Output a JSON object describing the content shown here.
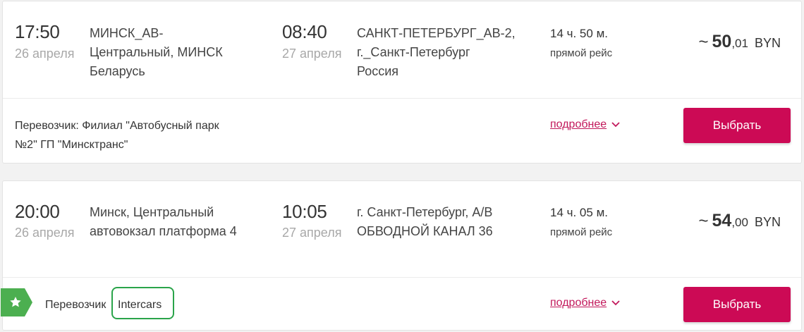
{
  "results": [
    {
      "depart_time": "17:50",
      "depart_date": "26 апреля",
      "depart_place_lines": [
        "МИНСК_АВ-",
        "Центральный, МИНСК",
        "Беларусь"
      ],
      "arrive_time": "08:40",
      "arrive_date": "27 апреля",
      "arrive_place_lines": [
        "САНКТ-ПЕТЕРБУРГ_АВ-2,",
        "г._Санкт-Петербург",
        "Россия"
      ],
      "duration": "14 ч. 50 м.",
      "trip_type": "прямой рейс",
      "price": {
        "approx": "~",
        "main": "50",
        "cents": ",01",
        "currency": "BYN"
      },
      "carrier_lines": [
        "Перевозчик: Филиал \"Автобусный парк",
        "№2\" ГП \"Минсктранс\""
      ],
      "more_label": "подробнее",
      "select_label": "Выбрать"
    },
    {
      "depart_time": "20:00",
      "depart_date": "26 апреля",
      "depart_place_lines": [
        "Минск, Центральный",
        "автовокзал платформа 4"
      ],
      "arrive_time": "10:05",
      "arrive_date": "27 апреля",
      "arrive_place_lines": [
        "г. Санкт-Петербург, А/В",
        "ОБВОДНОЙ КАНАЛ 36"
      ],
      "duration": "14 ч. 05 м.",
      "trip_type": "прямой рейс",
      "price": {
        "approx": "~",
        "main": "54",
        "cents": ",00",
        "currency": "BYN"
      },
      "carrier_label": "Перевозчик",
      "carrier_name": "Intercars",
      "more_label": "подробнее",
      "select_label": "Выбрать"
    }
  ],
  "colors": {
    "accent": "#cc0a55",
    "link": "#c2185b",
    "featured_tag": "#4caf50",
    "highlight": "#2aa44a"
  },
  "icons": {
    "featured": "star-icon",
    "expand": "chevron-down-icon"
  }
}
